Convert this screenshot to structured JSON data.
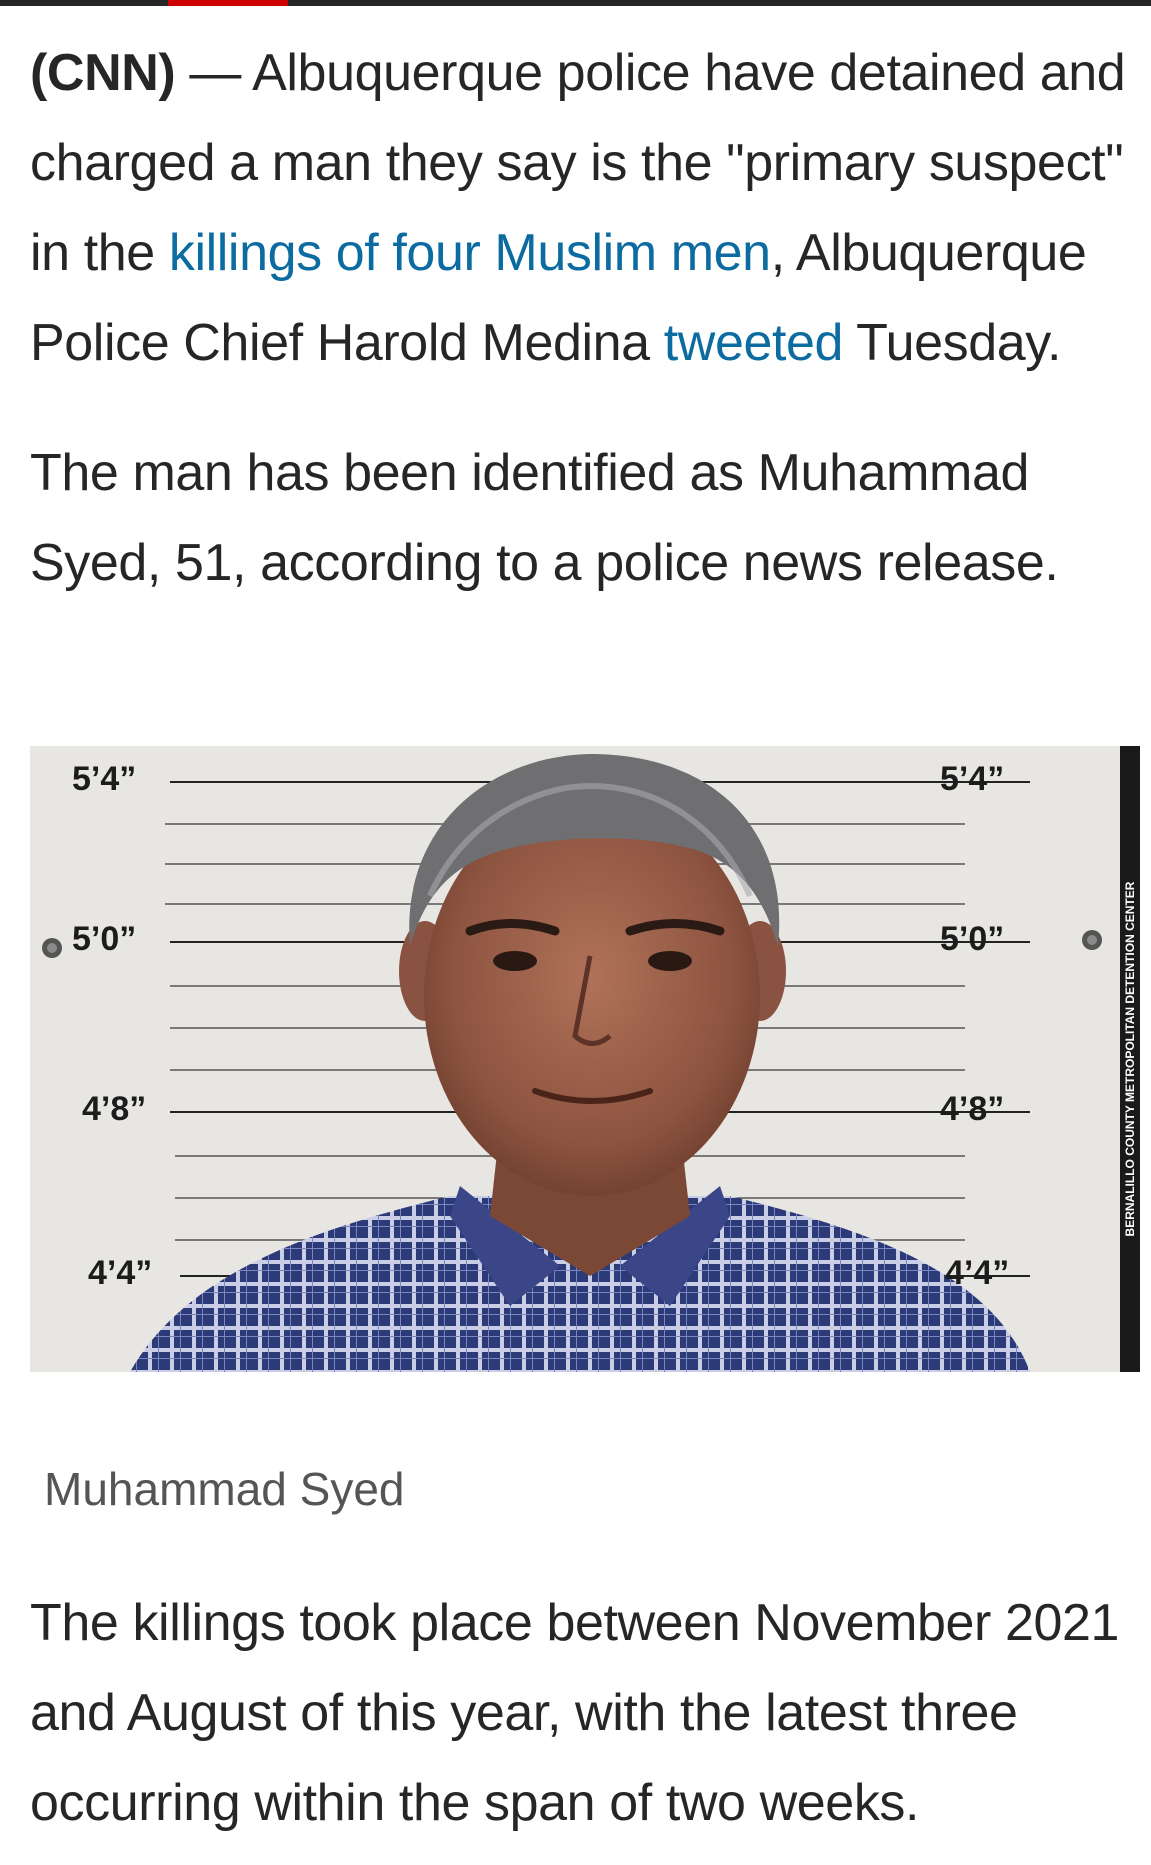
{
  "article": {
    "p1": {
      "byline": "(CNN)",
      "dash": " — ",
      "text_before_link": "Albuquerque police have detained and charged a man they say is the \"primary suspect\" in the ",
      "link1": "killings of four Muslim men",
      "text_between": ", Albuquerque Police Chief Harold Medina ",
      "link2": "tweeted",
      "text_after": " Tuesday."
    },
    "p2": "The man has been identified as Muhammad Syed, 51, according to a police news release.",
    "image": {
      "left_marks": [
        "5’4”",
        "5’0”",
        "4’8”",
        "4’4”"
      ],
      "right_marks": [
        "5’4”",
        "5’0”",
        "4’8”",
        "4’4”"
      ],
      "credit": "BERNALILLO COUNTY METROPOLITAN DETENTION CENTER"
    },
    "caption": "Muhammad Syed",
    "p3": "The killings took place between November 2021 and August of this year, with the latest three occurring within the span of two weeks."
  },
  "colors": {
    "link": "#0c6ba1",
    "text": "#262626",
    "accent": "#cc0000"
  }
}
